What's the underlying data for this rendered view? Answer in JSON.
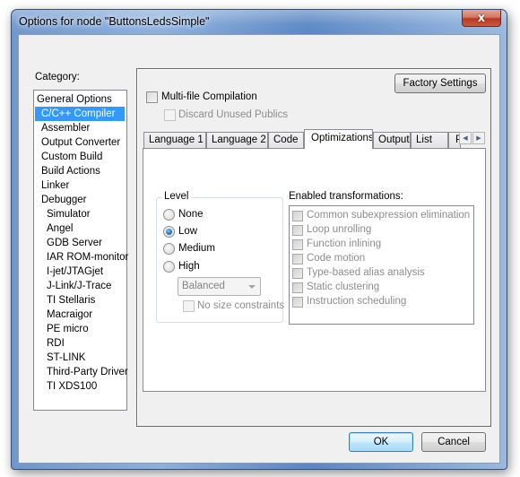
{
  "window": {
    "title": "Options for node \"ButtonsLedsSimple\"",
    "close_glyph": "x"
  },
  "category": {
    "label": "Category:",
    "selected": "C/C++ Compiler",
    "items": [
      {
        "label": "General Options",
        "level": 0
      },
      {
        "label": "C/C++ Compiler",
        "level": 1
      },
      {
        "label": "Assembler",
        "level": 1
      },
      {
        "label": "Output Converter",
        "level": 1
      },
      {
        "label": "Custom Build",
        "level": 1
      },
      {
        "label": "Build Actions",
        "level": 1
      },
      {
        "label": "Linker",
        "level": 1
      },
      {
        "label": "Debugger",
        "level": 1
      },
      {
        "label": "Simulator",
        "level": 2
      },
      {
        "label": "Angel",
        "level": 2
      },
      {
        "label": "GDB Server",
        "level": 2
      },
      {
        "label": "IAR ROM-monitor",
        "level": 2
      },
      {
        "label": "I-jet/JTAGjet",
        "level": 2
      },
      {
        "label": "J-Link/J-Trace",
        "level": 2
      },
      {
        "label": "TI Stellaris",
        "level": 2
      },
      {
        "label": "Macraigor",
        "level": 2
      },
      {
        "label": "PE micro",
        "level": 2
      },
      {
        "label": "RDI",
        "level": 2
      },
      {
        "label": "ST-LINK",
        "level": 2
      },
      {
        "label": "Third-Party Driver",
        "level": 2
      },
      {
        "label": "TI XDS100",
        "level": 2
      }
    ]
  },
  "panel": {
    "factory_settings_label": "Factory Settings",
    "multi_file_label": "Multi-file Compilation",
    "multi_file_checked": false,
    "discard_unused_label": "Discard Unused Publics",
    "discard_unused_checked": false,
    "discard_unused_enabled": false
  },
  "tabs": {
    "items": [
      {
        "label": "Language 1",
        "active": false
      },
      {
        "label": "Language 2",
        "active": false
      },
      {
        "label": "Code",
        "active": false
      },
      {
        "label": "Optimizations",
        "active": true
      },
      {
        "label": "Output",
        "active": false
      },
      {
        "label": "List",
        "active": false
      },
      {
        "label": "Preprocessor",
        "active": false
      }
    ],
    "scroll_left_glyph": "◀",
    "scroll_right_glyph": "▶"
  },
  "optimizations": {
    "level_legend": "Level",
    "level_options": [
      {
        "label": "None",
        "checked": false
      },
      {
        "label": "Low",
        "checked": true
      },
      {
        "label": "Medium",
        "checked": false
      },
      {
        "label": "High",
        "checked": false
      }
    ],
    "high_mode_value": "Balanced",
    "no_size_constraints_label": "No size constraints",
    "no_size_constraints_checked": false,
    "transformations_label": "Enabled transformations:",
    "transformations": [
      {
        "label": "Common subexpression elimination",
        "checked": false
      },
      {
        "label": "Loop unrolling",
        "checked": false
      },
      {
        "label": "Function inlining",
        "checked": false
      },
      {
        "label": "Code motion",
        "checked": false
      },
      {
        "label": "Type-based alias analysis",
        "checked": false
      },
      {
        "label": "Static clustering",
        "checked": false
      },
      {
        "label": "Instruction scheduling",
        "checked": false
      }
    ]
  },
  "footer": {
    "ok_label": "OK",
    "cancel_label": "Cancel"
  }
}
